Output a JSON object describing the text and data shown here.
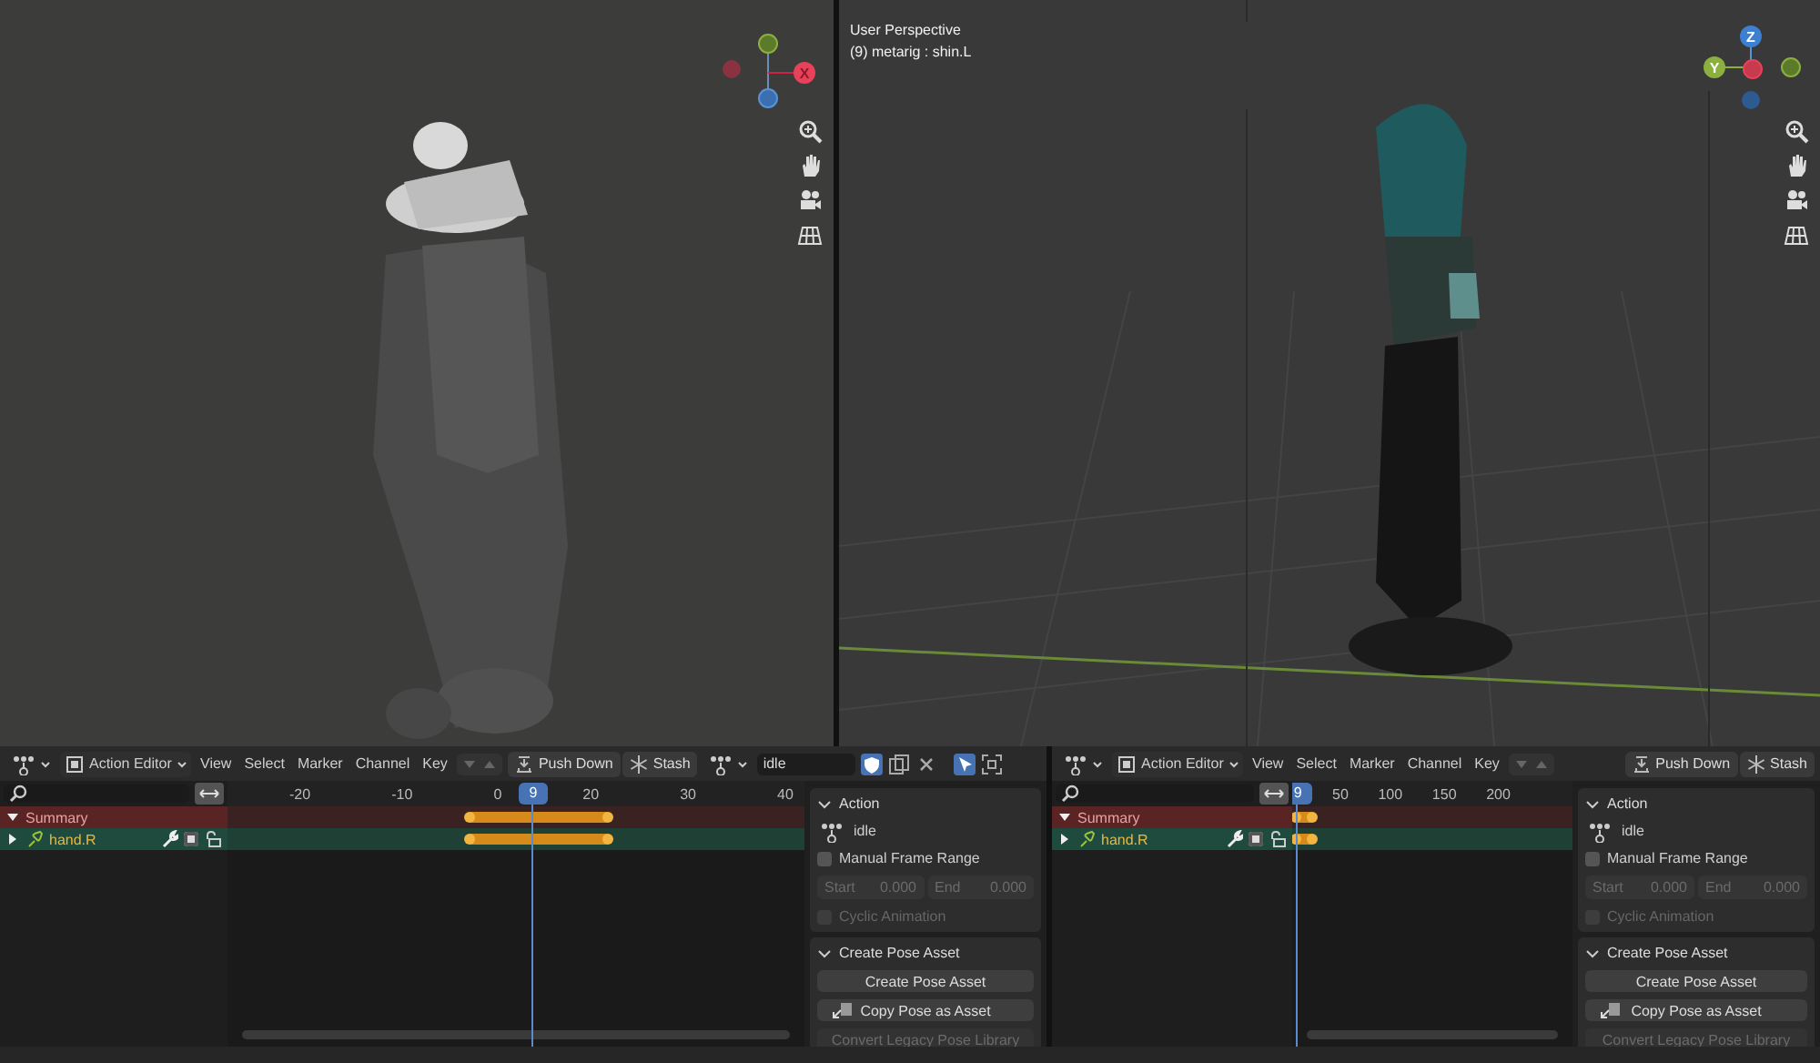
{
  "viewports": [
    {
      "kind": "solid",
      "gizmo_labels": [
        "X"
      ]
    },
    {
      "kind": "rendered",
      "info_lines": [
        "User Perspective",
        "(9) metarig : shin.L"
      ],
      "gizmo_labels": [
        "Z",
        "Y"
      ]
    }
  ],
  "editors": [
    {
      "editor_type": "Action Editor",
      "menus": [
        "View",
        "Select",
        "Marker",
        "Channel",
        "Key"
      ],
      "push_down": "Push Down",
      "stash": "Stash",
      "action": "idle",
      "ruler": [
        "-20",
        "-10",
        "0",
        "20",
        "30",
        "40"
      ],
      "playhead": {
        "frame": "9",
        "level": 0.53
      },
      "channels": [
        {
          "name": "Summary",
          "kind": "summary",
          "expanded": true
        },
        {
          "name": "hand.R",
          "kind": "group",
          "expanded": false,
          "checked": true
        }
      ],
      "sidebar": [
        {
          "title": "Action",
          "kind": "action",
          "expanded": true,
          "action": "idle",
          "manual_range": {
            "label": "Manual Frame Range",
            "checked": false
          },
          "range": [
            {
              "label": "Start",
              "value": "0.000",
              "disabled": true
            },
            {
              "label": "End",
              "value": "0.000",
              "disabled": true
            }
          ],
          "cyclic": {
            "label": "Cyclic Animation",
            "checked": false,
            "disabled": true
          }
        },
        {
          "title": "Create Pose Asset",
          "kind": "pose",
          "expanded": true,
          "buttons": [
            {
              "label": "Create Pose Asset",
              "disabled": false
            },
            {
              "label": "Copy Pose as Asset",
              "disabled": false,
              "icon": true
            },
            {
              "label": "Convert Legacy Pose Library",
              "disabled": true
            }
          ]
        }
      ]
    },
    {
      "editor_type": "Action Editor",
      "menus": [
        "View",
        "Select",
        "Marker",
        "Channel",
        "Key"
      ],
      "push_down": "Push Down",
      "stash": "Stash",
      "ruler": [
        "50",
        "100",
        "150",
        "200"
      ],
      "playhead": {
        "frame": "9",
        "level": 0.02
      },
      "channels": [
        {
          "name": "Summary",
          "kind": "summary",
          "expanded": true
        },
        {
          "name": "hand.R",
          "kind": "group",
          "expanded": false,
          "checked": true
        }
      ],
      "sidebar": [
        {
          "title": "Action",
          "kind": "action",
          "expanded": true,
          "action": "idle",
          "manual_range": {
            "label": "Manual Frame Range",
            "checked": false
          },
          "range": [
            {
              "label": "Start",
              "value": "0.000",
              "disabled": true
            },
            {
              "label": "End",
              "value": "0.000",
              "disabled": true
            }
          ],
          "cyclic": {
            "label": "Cyclic Animation",
            "checked": false,
            "disabled": true
          }
        },
        {
          "title": "Create Pose Asset",
          "kind": "pose",
          "expanded": true,
          "buttons": [
            {
              "label": "Create Pose Asset",
              "disabled": false
            },
            {
              "label": "Copy Pose as Asset",
              "disabled": false,
              "icon": true
            },
            {
              "label": "Convert Legacy Pose Library",
              "disabled": true
            }
          ]
        }
      ]
    }
  ]
}
